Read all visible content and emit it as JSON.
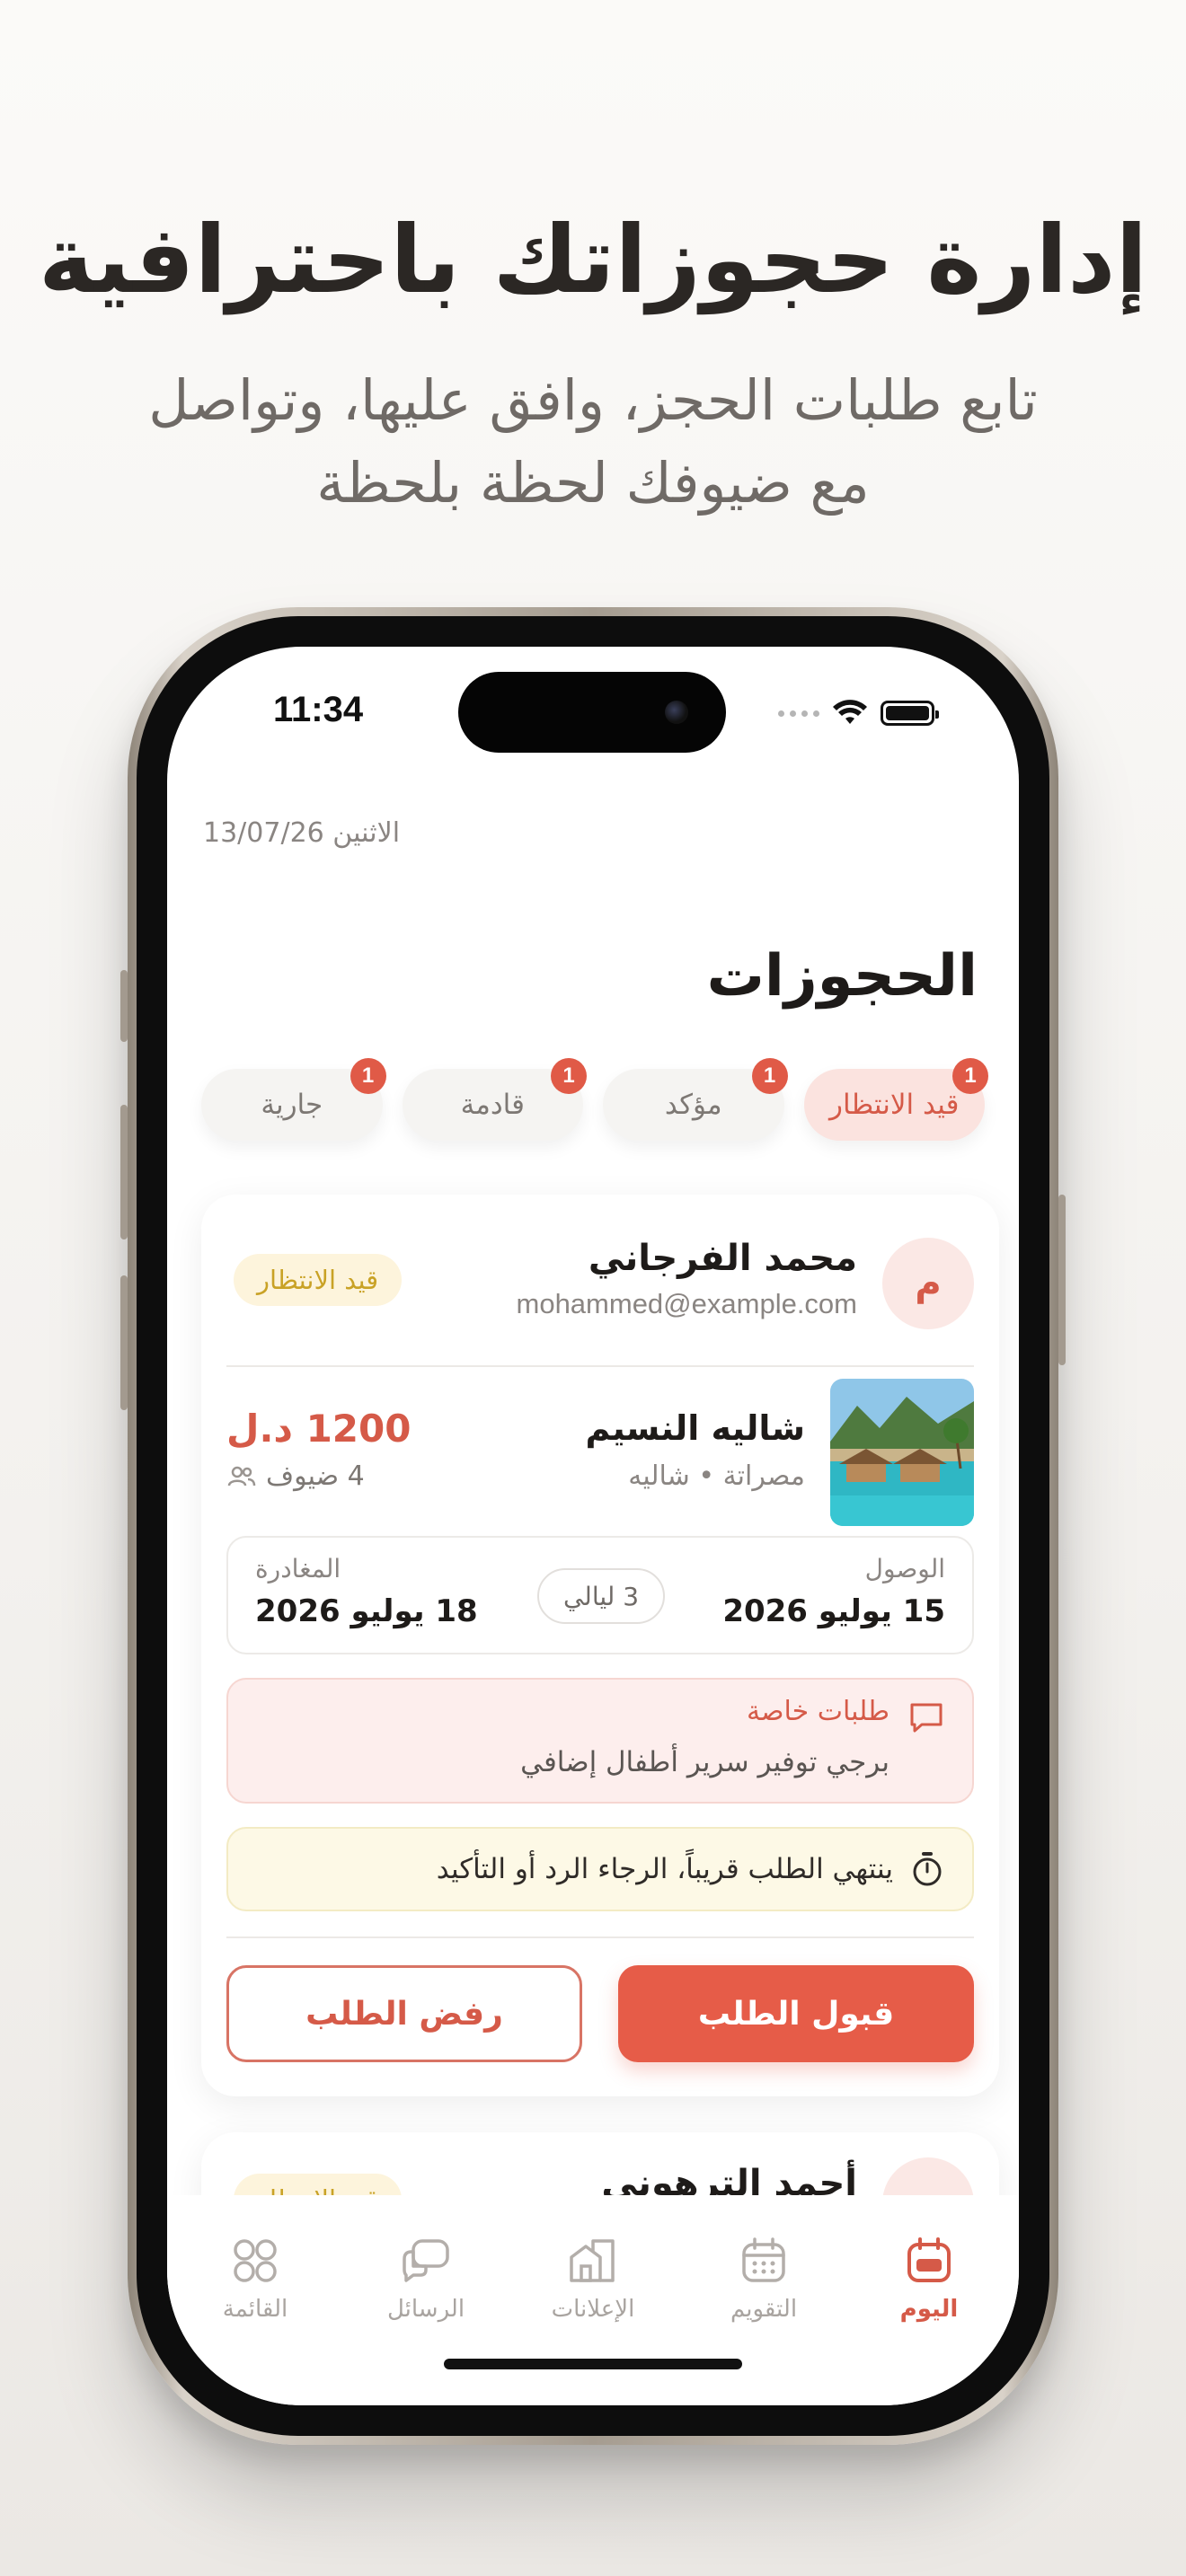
{
  "hero": {
    "title": "إدارة حجوزاتك باحترافية",
    "subtitle_line1": "تابع طلبات الحجز، وافق عليها، وتواصل",
    "subtitle_line2": "مع ضيوفك لحظة بلحظة"
  },
  "status_bar": {
    "time": "11:34"
  },
  "header": {
    "date": "الاثنين 13/07/26",
    "title": "الحجوزات"
  },
  "filter_tabs": [
    {
      "label": "قيد الانتظار",
      "count": "1",
      "active": true
    },
    {
      "label": "مؤكد",
      "count": "1",
      "active": false
    },
    {
      "label": "قادمة",
      "count": "1",
      "active": false
    },
    {
      "label": "جارية",
      "count": "1",
      "active": false
    }
  ],
  "booking": {
    "avatar_letter": "م",
    "guest_name": "محمد الفرجاني",
    "guest_email": "mohammed@example.com",
    "status": "قيد الانتظار",
    "property_name": "شاليه النسيم",
    "property_location": "مصراتة • شاليه",
    "price": "1200 د.ل",
    "guests": "4 ضيوف",
    "arrival_label": "الوصول",
    "arrival_date": "15 يوليو 2026",
    "departure_label": "المغادرة",
    "departure_date": "18 يوليو 2026",
    "nights": "3 ليالي",
    "special_requests_title": "طلبات خاصة",
    "special_requests_text": "برجي توفير سرير أطفال إضافي",
    "warning_text": "ينتهي الطلب قريباً، الرجاء الرد أو التأكيد",
    "accept_label": "قبول الطلب",
    "reject_label": "رفض الطلب"
  },
  "next_booking": {
    "guest_name": "أحمد الترهوني",
    "status": "قيد الانتظار"
  },
  "tab_bar": [
    {
      "label": "اليوم",
      "icon": "calendar-today-icon",
      "active": true
    },
    {
      "label": "التقويم",
      "icon": "calendar-grid-icon",
      "active": false
    },
    {
      "label": "الإعلانات",
      "icon": "listings-building-icon",
      "active": false
    },
    {
      "label": "الرسائل",
      "icon": "chat-bubbles-icon",
      "active": false
    },
    {
      "label": "القائمة",
      "icon": "menu-grid-icon",
      "active": false
    }
  ],
  "colors": {
    "accent": "#e65c48",
    "pending": "#c9a226",
    "text": "#1e1b19",
    "muted": "#8a8582"
  }
}
